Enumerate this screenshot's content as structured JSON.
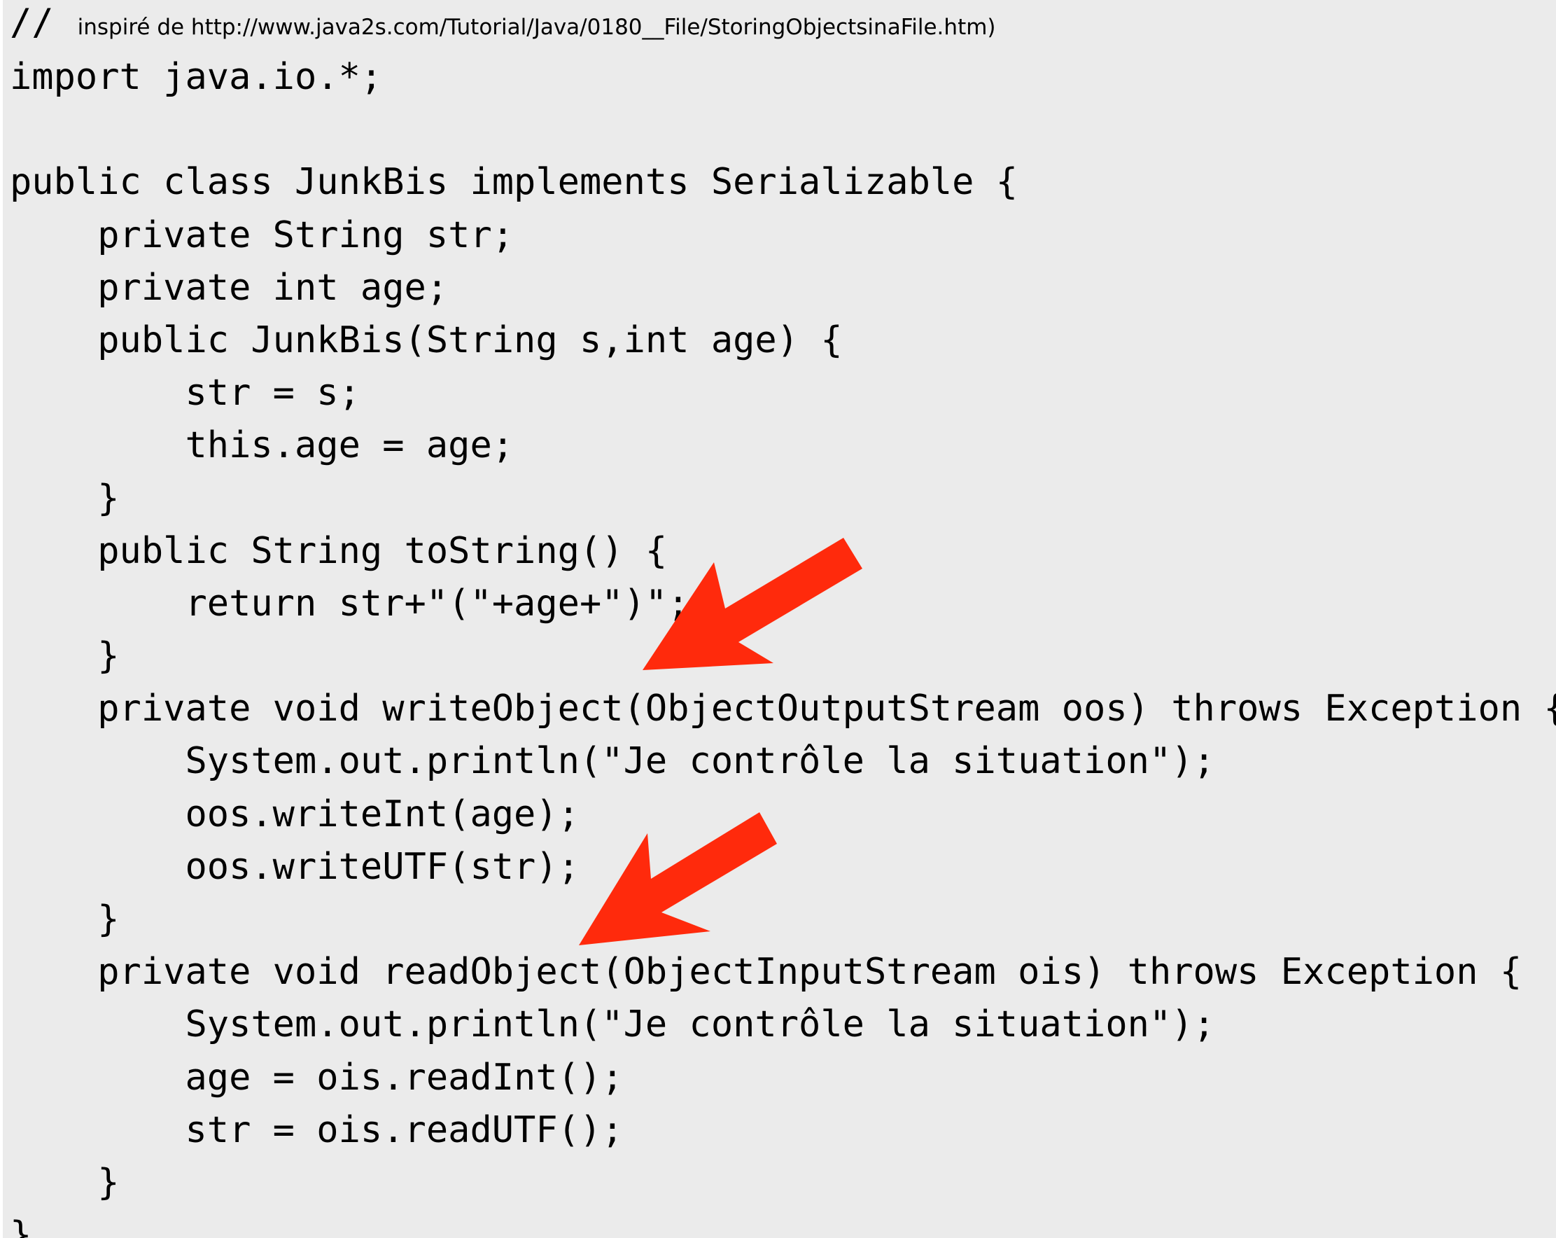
{
  "header": {
    "slashes": "//",
    "source_note": "inspiré de http://www.java2s.com/Tutorial/Java/0180__File/StoringObjectsinaFile.htm)"
  },
  "code": {
    "lines": [
      "import java.io.*;",
      "",
      "public class JunkBis implements Serializable {",
      "    private String str;",
      "    private int age;",
      "    public JunkBis(String s,int age) {",
      "        str = s;",
      "        this.age = age;",
      "    }",
      "    public String toString() {",
      "        return str+\"(\"+age+\")\";",
      "    }",
      "    private void writeObject(ObjectOutputStream oos) throws Exception {",
      "        System.out.println(\"Je contrôle la situation\");",
      "        oos.writeInt(age);",
      "        oos.writeUTF(str);",
      "    }",
      "    private void readObject(ObjectInputStream ois) throws Exception {",
      "        System.out.println(\"Je contrôle la situation\");",
      "        age = ois.readInt();",
      "        str = ois.readUTF();",
      "    }",
      "}"
    ]
  },
  "annotations": {
    "arrow_color": "#ff2a0c",
    "arrows": [
      {
        "icon": "red-arrow-icon",
        "points_to": "writeObject"
      },
      {
        "icon": "red-arrow-icon",
        "points_to": "readObject"
      }
    ]
  }
}
